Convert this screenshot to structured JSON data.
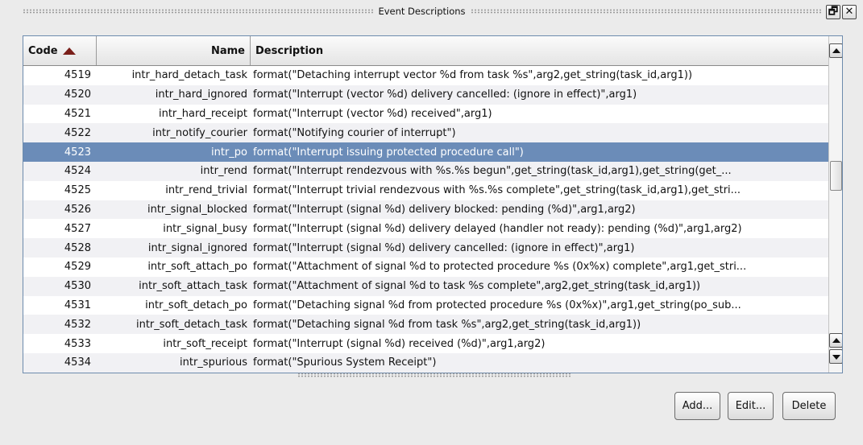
{
  "window": {
    "title": "Event Descriptions",
    "restore_glyph": "🗗",
    "close_glyph": "✕"
  },
  "table": {
    "columns": {
      "code": "Code",
      "name": "Name",
      "description": "Description"
    },
    "sort_column": "Code",
    "sort_direction": "ascending",
    "selected_code": "4523",
    "rows": [
      {
        "code": "4519",
        "name": "intr_hard_detach_task",
        "description": "format(\"Detaching interrupt vector %d from task %s\",arg2,get_string(task_id,arg1))"
      },
      {
        "code": "4520",
        "name": "intr_hard_ignored",
        "description": "format(\"Interrupt (vector %d) delivery cancelled: (ignore in effect)\",arg1)"
      },
      {
        "code": "4521",
        "name": "intr_hard_receipt",
        "description": "format(\"Interrupt (vector %d) received\",arg1)"
      },
      {
        "code": "4522",
        "name": "intr_notify_courier",
        "description": "format(\"Notifying courier of interrupt\")"
      },
      {
        "code": "4523",
        "name": "intr_po",
        "description": "format(\"Interrupt issuing protected procedure call\")"
      },
      {
        "code": "4524",
        "name": "intr_rend",
        "description": "format(\"Interrupt rendezvous with %s.%s begun\",get_string(task_id,arg1),get_string(get_..."
      },
      {
        "code": "4525",
        "name": "intr_rend_trivial",
        "description": "format(\"Interrupt trivial rendezvous with %s.%s complete\",get_string(task_id,arg1),get_stri..."
      },
      {
        "code": "4526",
        "name": "intr_signal_blocked",
        "description": "format(\"Interrupt (signal %d) delivery blocked: pending (%d)\",arg1,arg2)"
      },
      {
        "code": "4527",
        "name": "intr_signal_busy",
        "description": "format(\"Interrupt (signal %d) delivery delayed (handler not ready): pending (%d)\",arg1,arg2)"
      },
      {
        "code": "4528",
        "name": "intr_signal_ignored",
        "description": "format(\"Interrupt (signal %d) delivery cancelled: (ignore in effect)\",arg1)"
      },
      {
        "code": "4529",
        "name": "intr_soft_attach_po",
        "description": "format(\"Attachment of signal %d to protected procedure %s (0x%x) complete\",arg1,get_stri..."
      },
      {
        "code": "4530",
        "name": "intr_soft_attach_task",
        "description": "format(\"Attachment of signal %d to task %s complete\",arg2,get_string(task_id,arg1))"
      },
      {
        "code": "4531",
        "name": "intr_soft_detach_po",
        "description": "format(\"Detaching signal %d from protected procedure %s (0x%x)\",arg1,get_string(po_sub..."
      },
      {
        "code": "4532",
        "name": "intr_soft_detach_task",
        "description": "format(\"Detaching signal %d from task %s\",arg2,get_string(task_id,arg1))"
      },
      {
        "code": "4533",
        "name": "intr_soft_receipt",
        "description": "format(\"Interrupt (signal %d) received (%d)\",arg1,arg2)"
      },
      {
        "code": "4534",
        "name": "intr_spurious",
        "description": "format(\"Spurious System Receipt\")"
      }
    ]
  },
  "buttons": {
    "add": "Add...",
    "edit": "Edit...",
    "delete": "Delete"
  },
  "colors": {
    "selection": "#6b8cb8",
    "sort_arrow": "#7a1f1a",
    "table_border": "#6d8bad"
  }
}
